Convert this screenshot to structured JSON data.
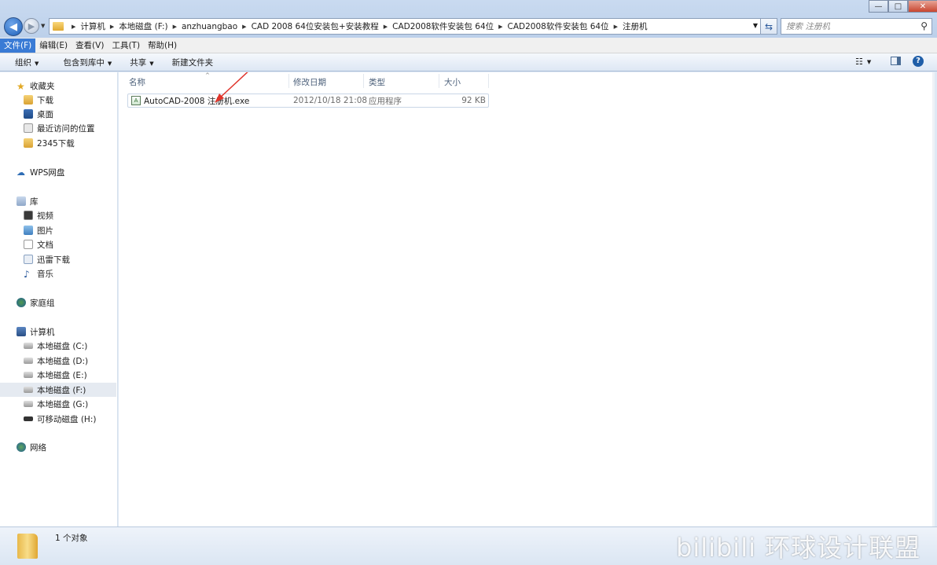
{
  "window": {
    "minimize_glyph": "—",
    "maximize_glyph": "□",
    "close_glyph": "✕"
  },
  "address": {
    "crumbs": [
      "计算机",
      "本地磁盘 (F:)",
      "anzhuangbao",
      "CAD 2008 64位安装包+安装教程",
      "CAD2008软件安装包 64位",
      "CAD2008软件安装包 64位",
      "注册机"
    ]
  },
  "search": {
    "placeholder": "搜索 注册机"
  },
  "menu": {
    "file": "文件(F)",
    "edit": "编辑(E)",
    "view": "查看(V)",
    "tools": "工具(T)",
    "help": "帮助(H)"
  },
  "toolbar": {
    "organize": "组织",
    "include_library": "包含到库中",
    "share": "共享",
    "new_folder": "新建文件夹"
  },
  "sidebar": {
    "favorites": "收藏夹",
    "downloads": "下载",
    "desktop": "桌面",
    "recent": "最近访问的位置",
    "d2345": "2345下载",
    "wps": "WPS网盘",
    "library": "库",
    "video": "视频",
    "pictures": "图片",
    "documents": "文档",
    "xunlei": "迅雷下载",
    "music": "音乐",
    "homegroup": "家庭组",
    "computer": "计算机",
    "drive_c": "本地磁盘 (C:)",
    "drive_d": "本地磁盘 (D:)",
    "drive_e": "本地磁盘 (E:)",
    "drive_f": "本地磁盘 (F:)",
    "drive_g": "本地磁盘 (G:)",
    "drive_h": "可移动磁盘 (H:)",
    "network": "网络"
  },
  "columns": {
    "name": "名称",
    "modified": "修改日期",
    "type": "类型",
    "size": "大小"
  },
  "files": [
    {
      "name": "AutoCAD-2008 注册机.exe",
      "modified": "2012/10/18 21:08",
      "type": "应用程序",
      "size": "92 KB"
    }
  ],
  "status": {
    "count": "1 个对象"
  },
  "watermark": {
    "text": "bilibili 环球设计联盟"
  },
  "colors": {
    "accent": "#3a7bd5",
    "arrow": "#e0342b"
  }
}
